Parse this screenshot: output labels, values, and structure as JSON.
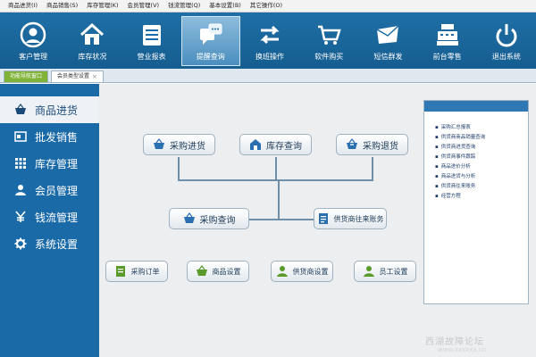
{
  "menubar": {
    "items": [
      "商品进货(I)",
      "商品销售(S)",
      "库存管理(K)",
      "会员管理(V)",
      "钱流管理(Q)",
      "基本设置(B)",
      "其它操作(O)"
    ]
  },
  "toolbar": {
    "buttons": [
      {
        "label": "客户管理",
        "icon": "user-circle-icon"
      },
      {
        "label": "库存状况",
        "icon": "house-icon"
      },
      {
        "label": "营业报表",
        "icon": "report-icon"
      },
      {
        "label": "提醒查询",
        "icon": "reminder-chat-icon",
        "active": true
      },
      {
        "label": "换班操作",
        "icon": "swap-arrows-icon"
      },
      {
        "label": "软件购买",
        "icon": "cart-icon"
      },
      {
        "label": "短信群发",
        "icon": "envelope-icon"
      },
      {
        "label": "前台零售",
        "icon": "cash-register-icon"
      },
      {
        "label": "退出系统",
        "icon": "power-icon"
      }
    ]
  },
  "tabs": {
    "nav_label": "功能导航窗口",
    "doc_label": "会员类型设置",
    "doc_close": "×"
  },
  "sidebar": {
    "items": [
      {
        "label": "商品进货",
        "icon": "basket-icon",
        "active": true
      },
      {
        "label": "批发销售",
        "icon": "card-icon"
      },
      {
        "label": "库存管理",
        "icon": "grid-icon"
      },
      {
        "label": "会员管理",
        "icon": "person-icon"
      },
      {
        "label": "钱流管理",
        "icon": "yen-icon"
      },
      {
        "label": "系统设置",
        "icon": "gear-icon"
      }
    ]
  },
  "diagram": {
    "purchase_in": "采购进货",
    "stock_query": "库存查询",
    "purchase_return": "采购退货",
    "purchase_query": "采购查询",
    "supplier_accounts": "供货商往来账务",
    "purchase_order": "采购订单",
    "product_settings": "商品设置",
    "supplier_settings": "供货商设置",
    "staff_settings": "员工设置"
  },
  "report_panel": {
    "items": [
      "采购汇总报表",
      "供货商商品销量查询",
      "供货商进货查询",
      "供货商事件跟踪",
      "商品进价分析",
      "商品进货与分析",
      "供货商往来账务",
      "经营方程"
    ]
  },
  "watermark": {
    "text": "西湖故障论坛",
    "sub": "www.xxxxxx.cn"
  },
  "colors": {
    "toolbar_blue": "#1a6aa8",
    "nav_tab_green": "#7fb236",
    "content_bg": "#eceef0"
  }
}
